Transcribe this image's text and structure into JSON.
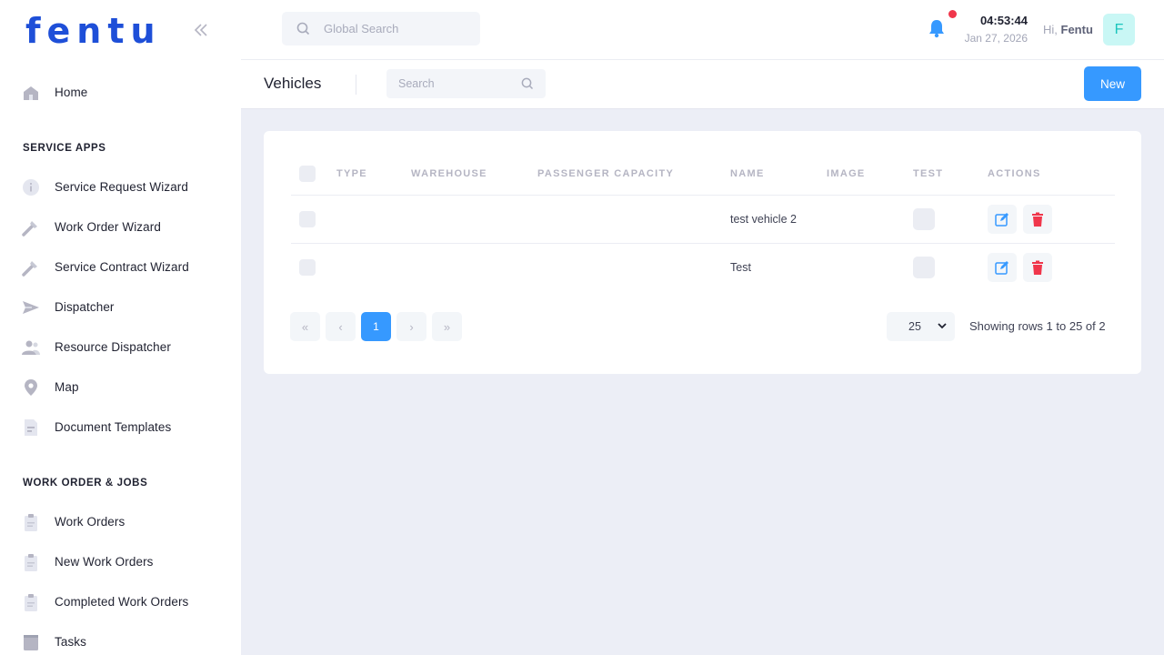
{
  "brand": {
    "name": "fentu"
  },
  "sidebar": {
    "home": {
      "label": "Home",
      "icon": "home-icon"
    },
    "section_service": "SERVICE APPS",
    "service_items": [
      {
        "label": "Service Request Wizard",
        "icon": "info-icon"
      },
      {
        "label": "Work Order Wizard",
        "icon": "wrench-icon"
      },
      {
        "label": "Service Contract Wizard",
        "icon": "wrench-icon"
      },
      {
        "label": "Dispatcher",
        "icon": "send-icon"
      },
      {
        "label": "Resource Dispatcher",
        "icon": "users-icon"
      },
      {
        "label": "Map",
        "icon": "map-pin-icon"
      },
      {
        "label": "Document Templates",
        "icon": "document-icon"
      }
    ],
    "section_work": "WORK ORDER & JOBS",
    "work_items": [
      {
        "label": "Work Orders",
        "icon": "clipboard-icon"
      },
      {
        "label": "New Work Orders",
        "icon": "clipboard-icon"
      },
      {
        "label": "Completed Work Orders",
        "icon": "clipboard-icon"
      },
      {
        "label": "Tasks",
        "icon": "tasks-icon"
      }
    ]
  },
  "topbar": {
    "search_placeholder": "Global Search",
    "time": "04:53:44",
    "date": "Jan 27, 2026",
    "greeting": "Hi,",
    "user_name": "Fentu",
    "avatar_initial": "F"
  },
  "subheader": {
    "title": "Vehicles",
    "search_placeholder": "Search",
    "new_label": "New"
  },
  "table": {
    "columns": [
      "TYPE",
      "WAREHOUSE",
      "PASSENGER CAPACITY",
      "NAME",
      "IMAGE",
      "TEST",
      "ACTIONS"
    ],
    "rows": [
      {
        "type": "",
        "warehouse": "",
        "passenger_capacity": "",
        "name": "test vehicle 2",
        "image": "",
        "test": false
      },
      {
        "type": "",
        "warehouse": "",
        "passenger_capacity": "",
        "name": "Test",
        "image": "",
        "test": false
      }
    ]
  },
  "pagination": {
    "first": "«",
    "prev": "‹",
    "current_page": "1",
    "next": "›",
    "last": "»",
    "rows_per_page": "25",
    "info": "Showing rows 1 to 25 of 2"
  },
  "colors": {
    "brand": "#1e4fd8",
    "primary": "#3699ff",
    "danger": "#f0364b",
    "page_bg": "#eceef6",
    "avatar_bg": "#c9f7f5",
    "avatar_text": "#1bc5bd"
  }
}
